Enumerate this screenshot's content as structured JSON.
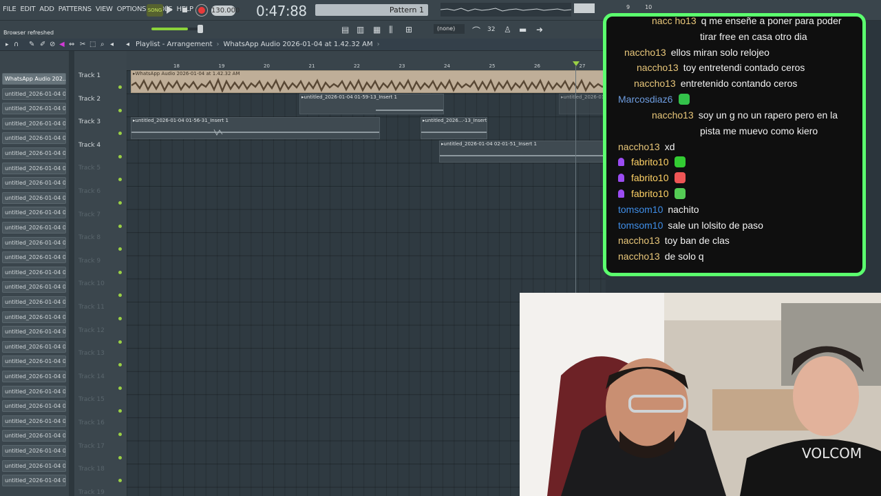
{
  "menu": [
    "FILE",
    "EDIT",
    "ADD",
    "PATTERNS",
    "VIEW",
    "OPTIONS",
    "TOOLS",
    "HELP"
  ],
  "transport": {
    "song_label": "SONG",
    "tempo": "130.000",
    "time": "0:47:88",
    "pattern": "Pattern 1",
    "cpu_labels": [
      "9",
      "10"
    ]
  },
  "status_hint": "Browser refreshed",
  "snap": "(none)",
  "playlist": {
    "title": "Playlist - Arrangement",
    "sep": "›",
    "clip_name": "WhatsApp Audio 2026-01-04 at 1.42.32 AM",
    "sep2": "›"
  },
  "browser": {
    "items": [
      "WhatsApp Audio 202...",
      "untitled_2026-01-04 01-...",
      "untitled_2026-01-04 01-...",
      "untitled_2026-01-04 01-...",
      "untitled_2026-01-04 01-...",
      "untitled_2026-01-04 01-...",
      "untitled_2026-01-04 01-...",
      "untitled_2026-01-04 01-...",
      "untitled_2026-01-04 01-...",
      "untitled_2026-01-04 01-...",
      "untitled_2026-01-04 01-...",
      "untitled_2026-01-04 01-...",
      "untitled_2026-01-04 01-...",
      "untitled_2026-01-04 01-...",
      "untitled_2026-01-04 01-...",
      "untitled_2026-01-04 01-...",
      "untitled_2026-01-04 01-...",
      "untitled_2026-01-04 01-...",
      "untitled_2026-01-04 01-...",
      "untitled_2026-01-04 01-...",
      "untitled_2026-01-04 01-...",
      "untitled_2026-01-04 01-...",
      "untitled_2026-01-04 01-...",
      "untitled_2026-01-04 01-...",
      "untitled_2026-01-04 01-...",
      "untitled_2026-01-04 01-...",
      "untitled_2026-01-04 01-...",
      "untitled_2026-01-04 01-..."
    ]
  },
  "tracks": [
    "Track 1",
    "Track 2",
    "Track 3",
    "Track 4",
    "Track 5",
    "Track 6",
    "Track 7",
    "Track 8",
    "Track 9",
    "Track 10",
    "Track 11",
    "Track 12",
    "Track 13",
    "Track 14",
    "Track 15",
    "Track 16",
    "Track 17",
    "Track 18",
    "Track 19"
  ],
  "ruler": [
    "18",
    "19",
    "20",
    "21",
    "22",
    "23",
    "24",
    "25",
    "26",
    "27"
  ],
  "clips": {
    "c1": "WhatsApp Audio 2026-01-04 at 1.42.32 AM",
    "c2": "untitled_2026-01-04 01-59-13_Insert 1",
    "c3": "untitled_2026-01-04 01-56-31_Insert 1",
    "c4": "untitled_2026...-13_Insert 1",
    "c5": "untitled_2026-01-04 02-01-51_Insert 1",
    "c6": "untitled_2026-01-"
  },
  "chat": [
    {
      "user": "nacc ho13",
      "text": "q me enseñe a poner para poder"
    },
    {
      "user": "",
      "text": "tirar free en casa otro dia"
    },
    {
      "user": "naccho13",
      "text": "ellos miran solo relojeo"
    },
    {
      "user": "naccho13",
      "text": "toy entretendi contado ceros"
    },
    {
      "user": "naccho13",
      "text": "entretenido contando ceros"
    },
    {
      "user": "Marcosdiaz6",
      "text": ""
    },
    {
      "user": "naccho13",
      "text": "soy un g no un rapero pero en la"
    },
    {
      "user": "",
      "text": "pista me muevo como kiero"
    },
    {
      "user": "naccho13",
      "text": "xd"
    },
    {
      "user": "fabrito10",
      "text": ""
    },
    {
      "user": "fabrito10",
      "text": ""
    },
    {
      "user": "fabrito10",
      "text": ""
    },
    {
      "user": "tomsom10",
      "text": "nachito"
    },
    {
      "user": "tomsom10",
      "text": "sale un lolsito de paso"
    },
    {
      "user": "naccho13",
      "text": "toy ban de clas"
    },
    {
      "user": "naccho13",
      "text": "de solo q"
    }
  ],
  "colors": {
    "chat_border": "#5bff6e",
    "accent_green": "#9ad045",
    "record": "#e93a3a"
  }
}
